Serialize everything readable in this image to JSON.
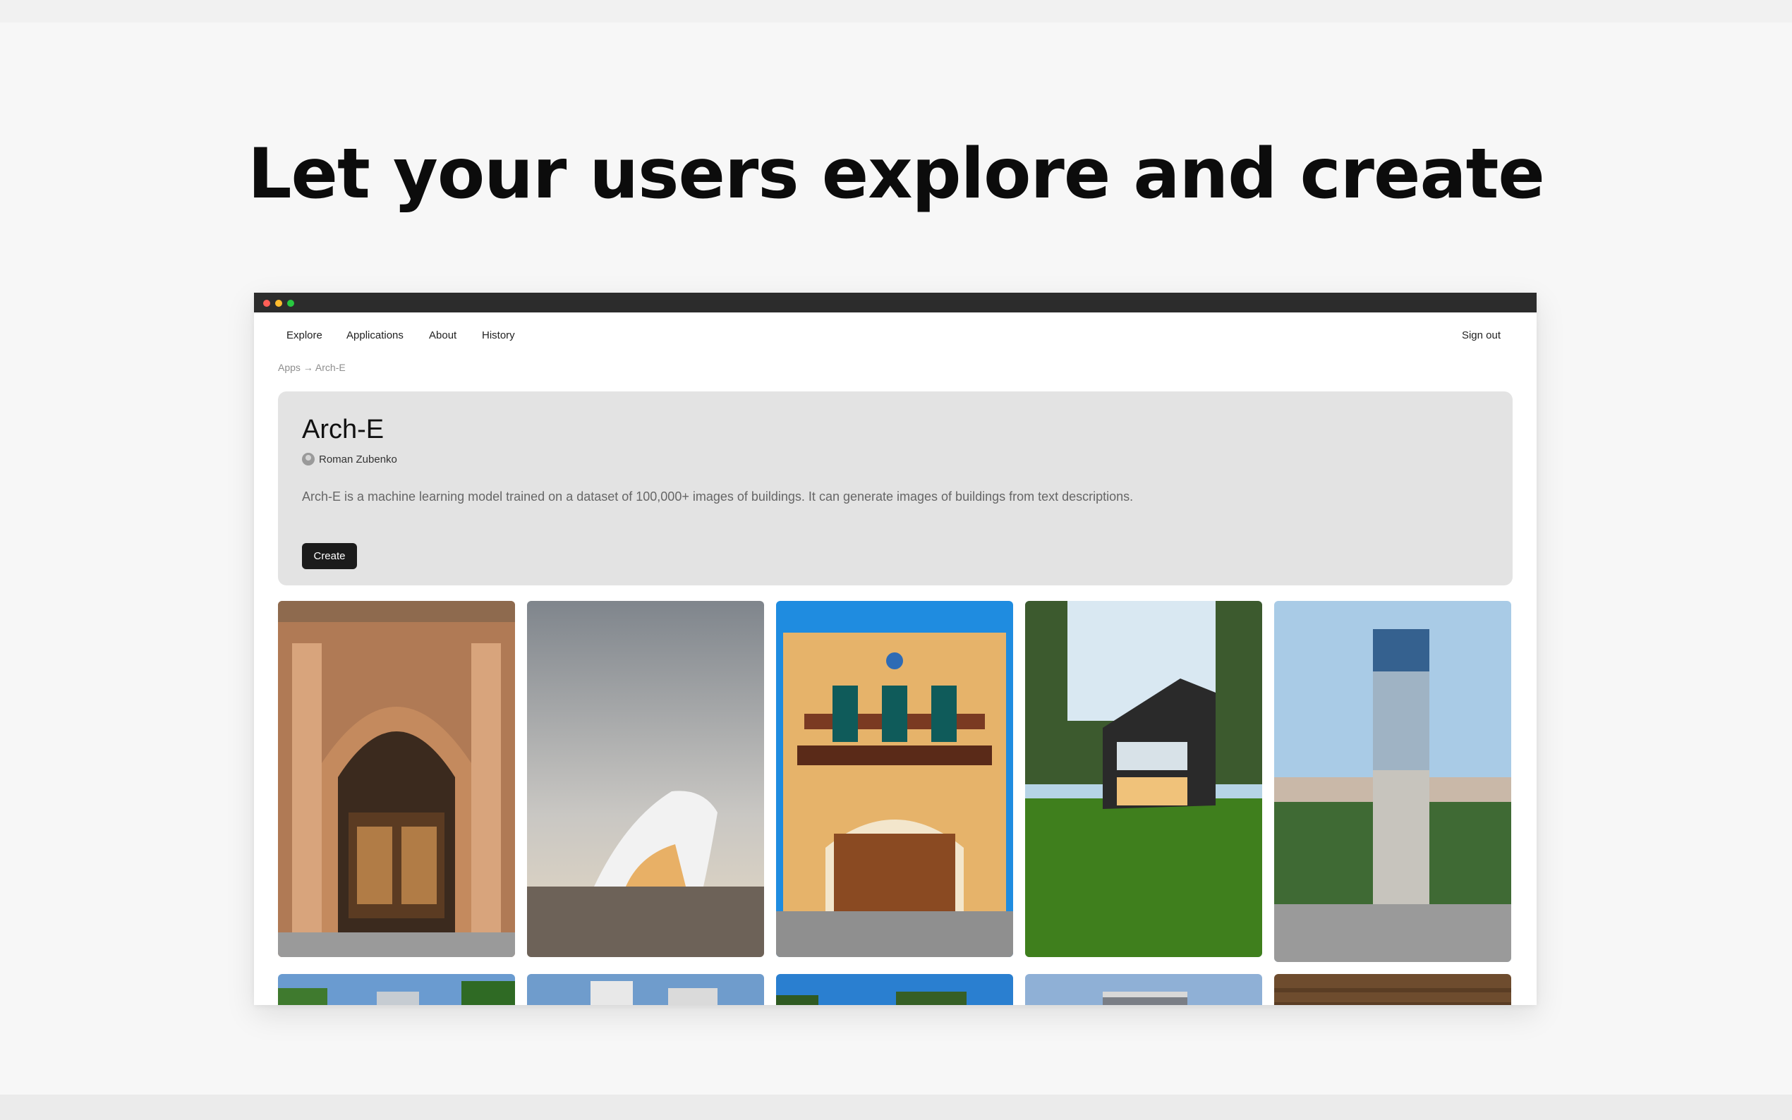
{
  "headline": "Let your users explore and create",
  "nav": {
    "items": [
      {
        "label": "Explore"
      },
      {
        "label": "Applications"
      },
      {
        "label": "About"
      },
      {
        "label": "History"
      }
    ],
    "sign_out": "Sign out"
  },
  "breadcrumb": "Apps → Arch-E",
  "app": {
    "title": "Arch-E",
    "author": "Roman Zubenko",
    "description": "Arch-E is a machine learning model trained on a dataset of 100,000+ images of buildings. It can generate images of buildings from text descriptions.",
    "create_label": "Create"
  },
  "gallery": {
    "items": [
      {
        "subject": "ornate arched storefront"
      },
      {
        "subject": "white curved modern building at sunset"
      },
      {
        "subject": "colonial facade with balconies"
      },
      {
        "subject": "modern glass house on lawn"
      },
      {
        "subject": "glass skyscraper above city"
      },
      {
        "subject": "modern building under trees"
      },
      {
        "subject": "white modern building"
      },
      {
        "subject": "trees against blue sky"
      },
      {
        "subject": "round tower"
      },
      {
        "subject": "wooden structure"
      }
    ]
  }
}
